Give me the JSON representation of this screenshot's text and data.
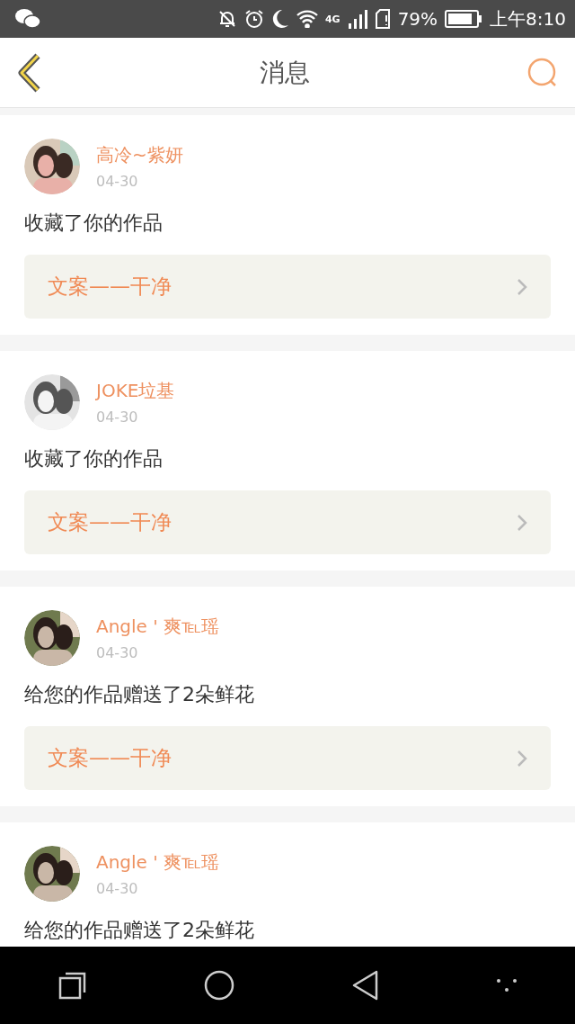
{
  "status_bar": {
    "network": "4G",
    "battery": "79%",
    "time": "上午8:10"
  },
  "header": {
    "title": "消息"
  },
  "messages": [
    {
      "name": "高冷~紫妍",
      "date": "04-30",
      "action": "收藏了你的作品",
      "work_title": "文案——干净"
    },
    {
      "name": "JOKE垃基",
      "date": "04-30",
      "action": "收藏了你的作品",
      "work_title": "文案——干净"
    },
    {
      "name": "Angle ' 爽℡瑶",
      "date": "04-30",
      "action": "给您的作品赠送了2朵鲜花",
      "work_title": "文案——干净"
    },
    {
      "name": "Angle ' 爽℡瑶",
      "date": "04-30",
      "action": "给您的作品赠送了2朵鲜花"
    }
  ]
}
